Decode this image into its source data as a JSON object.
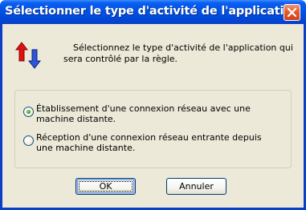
{
  "window": {
    "title": "Sélectionner le type d'activité de l'application"
  },
  "description": "Sélectionnez le type d'activité de l'application qui sera contrôlé par la règle.",
  "options": [
    {
      "label": "Établissement d'une connexion réseau avec une machine distante.",
      "selected": true
    },
    {
      "label": "Réception d'une connexion réseau entrante depuis une machine distante.",
      "selected": false
    }
  ],
  "buttons": {
    "ok_label": "OK",
    "cancel_label": "Annuler"
  },
  "icons": {
    "close": "close-icon",
    "activity": "up-down-arrows-icon"
  },
  "colors": {
    "titlebar": "#0055e5",
    "close_button": "#e35a2c",
    "client_bg": "#ece9d8",
    "radio_dot": "#2ea72d",
    "arrow_up": "#e01010",
    "arrow_down": "#2f56d8"
  }
}
